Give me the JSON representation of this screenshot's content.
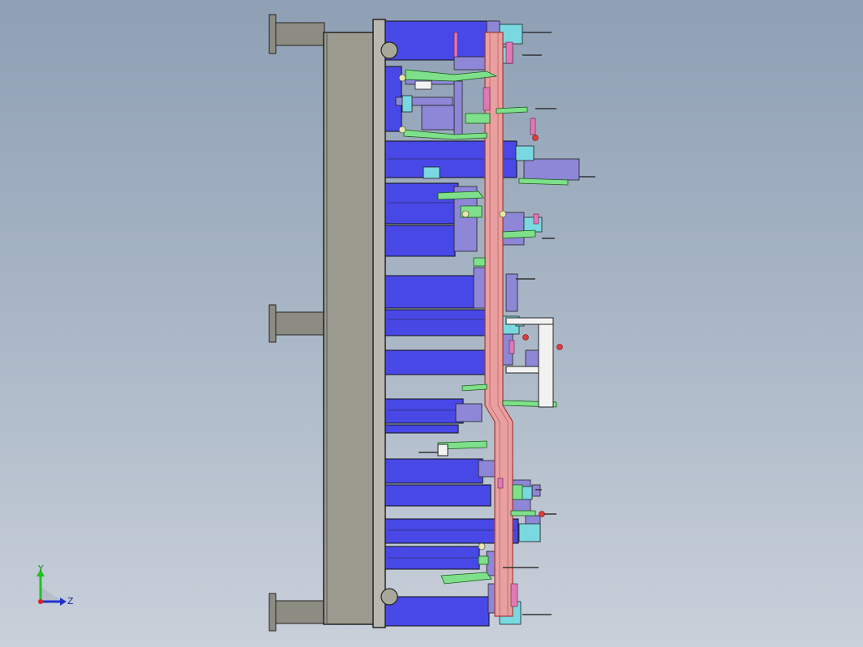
{
  "window": {
    "type": "cad-viewport",
    "background_top": "#8fa0b5",
    "background_bottom": "#c9d0da"
  },
  "model": {
    "description_colors": {
      "blue_block": "#4848e6",
      "purple_part": "#8e86d6",
      "tube": "#e58a8a",
      "clamp_arm": "#7ee08a",
      "cyan_part": "#7ad8e0",
      "pink_pin": "#e07ab6",
      "gray_plate": "#9a9a8e",
      "gray_post": "#8c8c82"
    }
  },
  "triad": {
    "y_label": "Y",
    "z_label": "Z",
    "y_color": "#22c022",
    "z_color": "#2233cc",
    "origin_color": "#dd2222",
    "icons": [
      "y-axis-arrow-icon",
      "z-axis-arrow-icon",
      "origin-dot-icon"
    ]
  }
}
